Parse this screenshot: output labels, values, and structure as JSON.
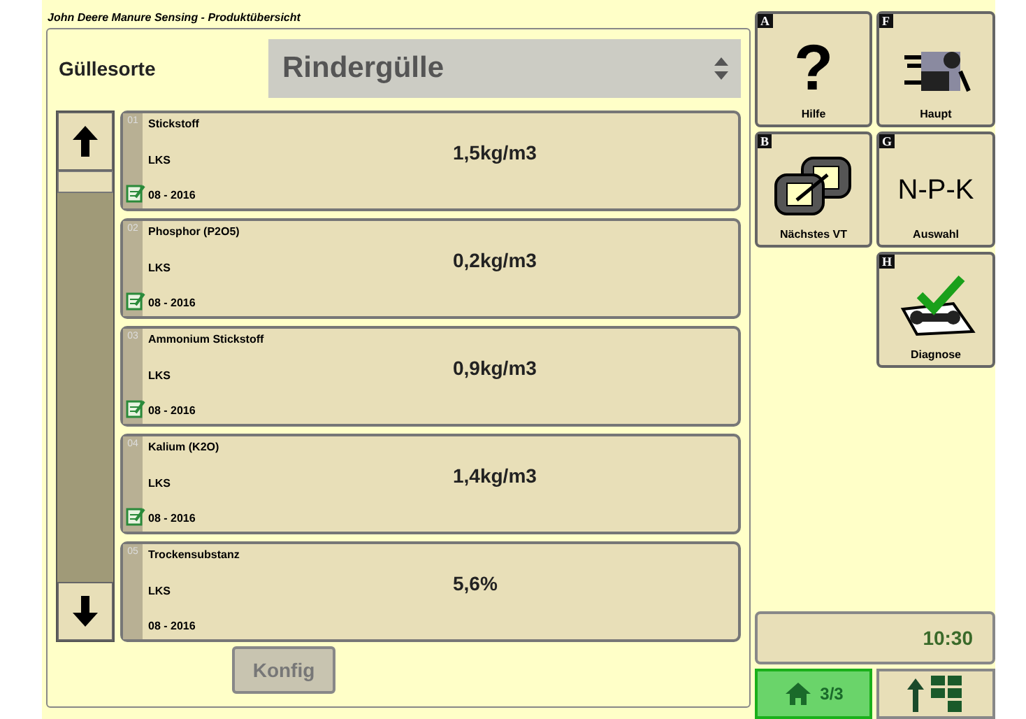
{
  "title": "John Deere Manure Sensing - Produktübersicht",
  "manure_type": {
    "label": "Güllesorte",
    "value": "Rindergülle"
  },
  "items": [
    {
      "number": "01",
      "name": "Stickstoff",
      "source": "LKS",
      "date": "08 - 2016",
      "edited": true,
      "value": "1,5kg/m3"
    },
    {
      "number": "02",
      "name": "Phosphor (P2O5)",
      "source": "LKS",
      "date": "08 - 2016",
      "edited": true,
      "value": "0,2kg/m3"
    },
    {
      "number": "03",
      "name": "Ammonium Stickstoff",
      "source": "LKS",
      "date": "08 - 2016",
      "edited": true,
      "value": "0,9kg/m3"
    },
    {
      "number": "04",
      "name": "Kalium (K2O)",
      "source": "LKS",
      "date": "08 - 2016",
      "edited": true,
      "value": "1,4kg/m3"
    },
    {
      "number": "05",
      "name": "Trockensubstanz",
      "source": "LKS",
      "date": "08 - 2016",
      "edited": false,
      "value": "5,6%"
    }
  ],
  "config_button": {
    "label": "Konfig",
    "disabled": true
  },
  "softkeys": [
    {
      "key": "A",
      "kind": "help",
      "label": "Hilfe",
      "glyph": "?"
    },
    {
      "key": "F",
      "kind": "main",
      "label": "Haupt"
    },
    {
      "key": "B",
      "kind": "next",
      "label": "Nächstes VT"
    },
    {
      "key": "G",
      "kind": "text",
      "label": "Auswahl",
      "glyph": "N-P-K"
    },
    {
      "key": "H",
      "kind": "diagnose",
      "label": "Diagnose"
    }
  ],
  "clock": "10:30",
  "home_tab": {
    "label": "3/3",
    "selected": true
  }
}
